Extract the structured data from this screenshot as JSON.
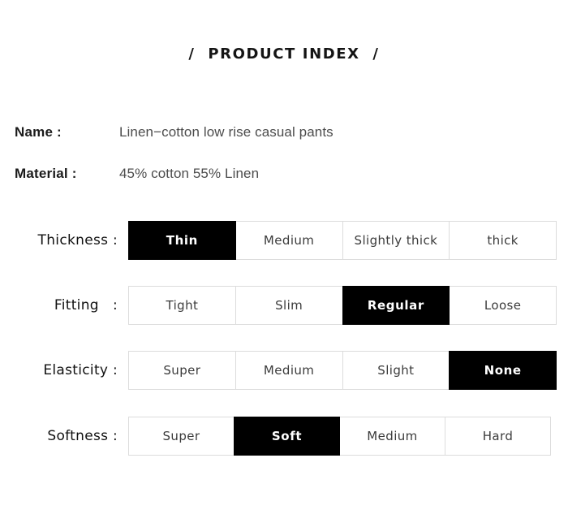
{
  "header": {
    "title": "/  PRODUCT INDEX  /"
  },
  "info": [
    {
      "label": "Name :",
      "value": "Linen−cotton low rise casual pants"
    },
    {
      "label": "Material :",
      "value": "45% cotton 55% Linen"
    }
  ],
  "specs": [
    {
      "label": "Thickness :",
      "selected_index": 0,
      "options": [
        {
          "label": "Thin"
        },
        {
          "label": "Medium"
        },
        {
          "label": "Slightly thick"
        },
        {
          "label": "thick"
        }
      ]
    },
    {
      "label": "Fitting   :",
      "selected_index": 2,
      "options": [
        {
          "label": "Tight"
        },
        {
          "label": "Slim"
        },
        {
          "label": "Regular"
        },
        {
          "label": "Loose"
        }
      ]
    },
    {
      "label": "Elasticity :",
      "selected_index": 3,
      "options": [
        {
          "label": "Super"
        },
        {
          "label": "Medium"
        },
        {
          "label": "Slight"
        },
        {
          "label": "None"
        }
      ]
    },
    {
      "label": "Softness :",
      "selected_index": 1,
      "options": [
        {
          "label": "Super"
        },
        {
          "label": "Soft"
        },
        {
          "label": "Medium"
        },
        {
          "label": "Hard"
        }
      ]
    }
  ],
  "colors": {
    "background": "#ffffff",
    "selected_background": "#000000",
    "selected_text": "#ffffff",
    "cell_border": "#dcdcdc",
    "cell_text": "#3b3b3b",
    "label_text": "#111111",
    "value_text": "#4c4c4c",
    "title_text": "#141414"
  }
}
